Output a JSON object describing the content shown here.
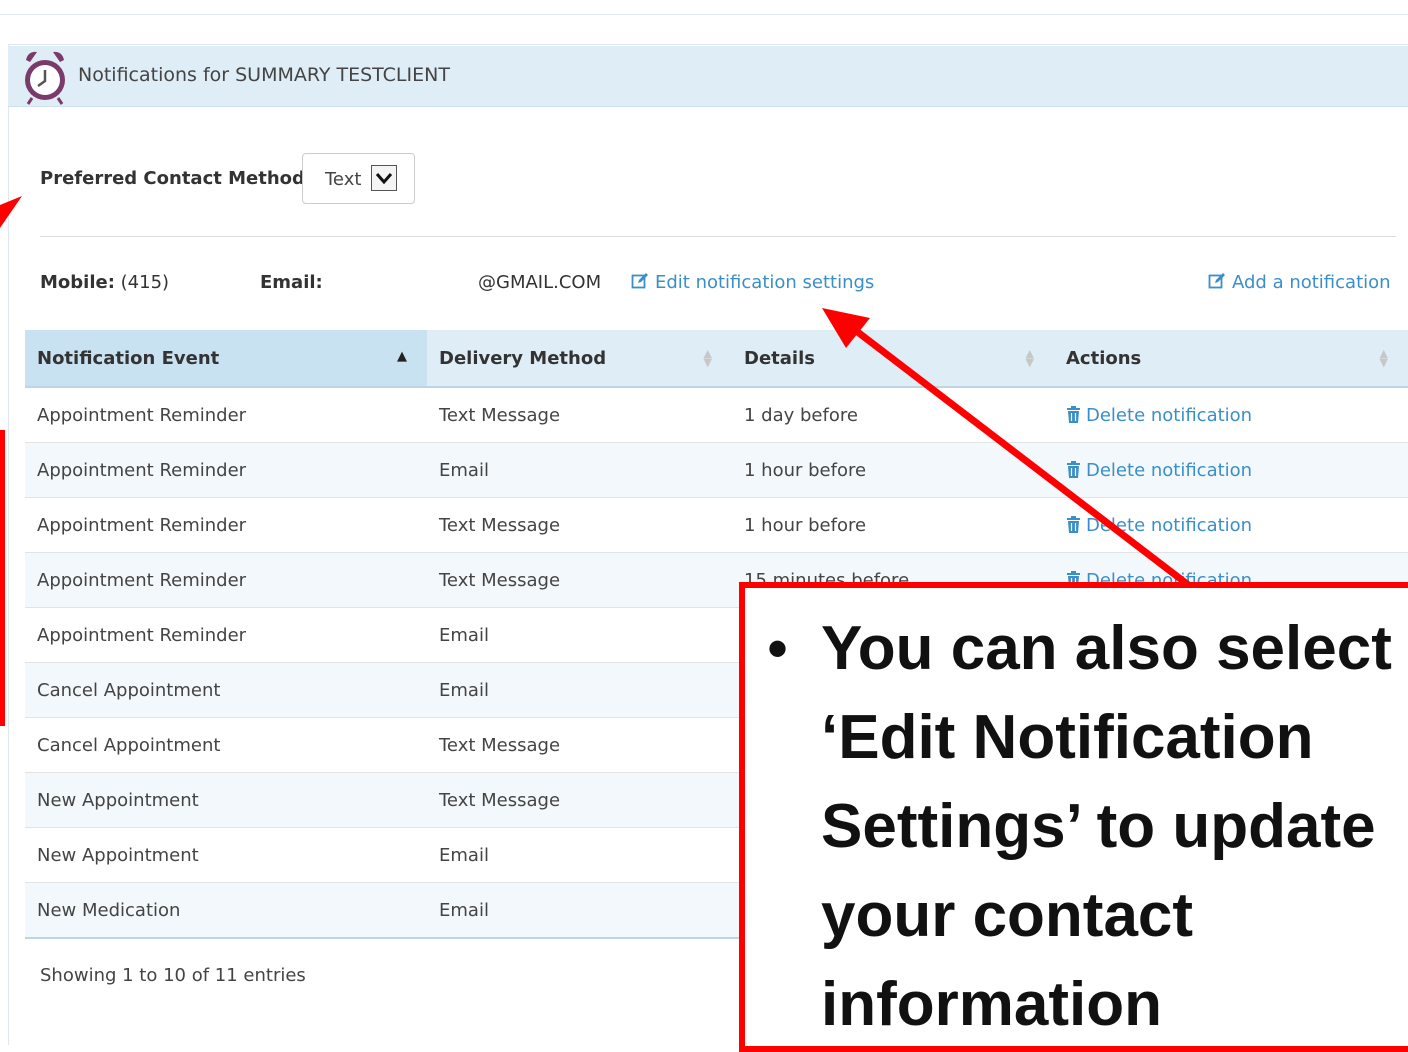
{
  "panel": {
    "title": "Notifications for SUMMARY TESTCLIENT"
  },
  "preferences": {
    "label": "Preferred Contact Method",
    "selected": "Text"
  },
  "contact": {
    "mobile_label": "Mobile:",
    "mobile_value": "(415)",
    "email_label": "Email:",
    "email_value": "@GMAIL.COM",
    "edit_link": "Edit notification settings",
    "add_link": "Add a notification"
  },
  "table": {
    "columns": [
      "Notification Event",
      "Delivery Method",
      "Details",
      "Actions"
    ],
    "delete_label": "Delete notification",
    "rows": [
      {
        "event": "Appointment Reminder",
        "method": "Text Message",
        "details": "1 day before"
      },
      {
        "event": "Appointment Reminder",
        "method": "Email",
        "details": "1 hour before"
      },
      {
        "event": "Appointment Reminder",
        "method": "Text Message",
        "details": "1 hour before"
      },
      {
        "event": "Appointment Reminder",
        "method": "Text Message",
        "details": "15 minutes before"
      },
      {
        "event": "Appointment Reminder",
        "method": "Email",
        "details": ""
      },
      {
        "event": "Cancel Appointment",
        "method": "Email",
        "details": ""
      },
      {
        "event": "Cancel Appointment",
        "method": "Text Message",
        "details": ""
      },
      {
        "event": "New Appointment",
        "method": "Text Message",
        "details": ""
      },
      {
        "event": "New Appointment",
        "method": "Email",
        "details": ""
      },
      {
        "event": "New Medication",
        "method": "Email",
        "details": ""
      }
    ]
  },
  "footer": {
    "entries": "Showing 1 to 10 of 11 entries"
  },
  "callout": {
    "bullet": "•",
    "text": "You can also select ‘Edit Notification Settings’ to update your contact information"
  },
  "colors": {
    "accent": "#3a8fc8",
    "header_bg": "#deedf6",
    "annotation_red": "#ff0000"
  }
}
